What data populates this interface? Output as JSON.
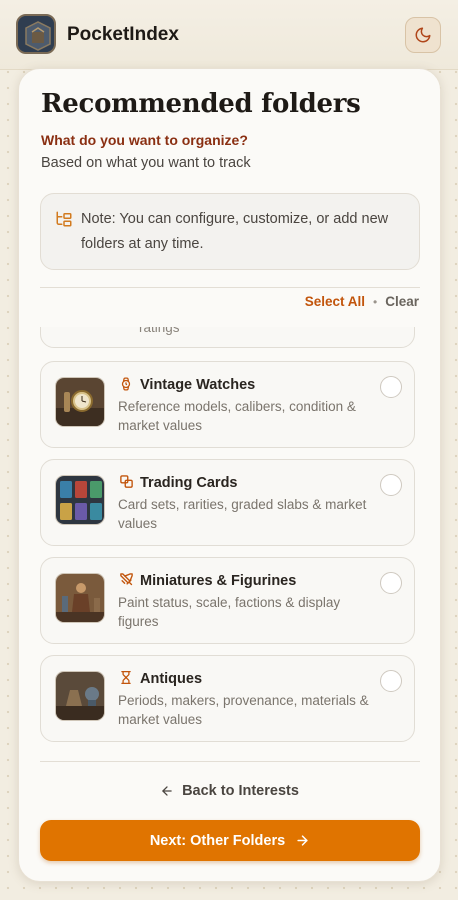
{
  "app": {
    "title": "PocketIndex"
  },
  "header": {
    "title": "Recommended folders",
    "question": "What do you want to organize?",
    "subtitle": "Based on what you want to track"
  },
  "note": {
    "text": "Note: You can configure, customize, or add new folders at any time."
  },
  "selection": {
    "select_all": "Select All",
    "separator": "•",
    "clear": "Clear"
  },
  "folders": [
    {
      "title": "",
      "desc": "ratings",
      "icon": "partial",
      "checked": false
    },
    {
      "title": "Vintage Watches",
      "desc": "Reference models, calibers, condition & market values",
      "icon": "watch-icon",
      "checked": false
    },
    {
      "title": "Trading Cards",
      "desc": "Card sets, rarities, graded slabs & market values",
      "icon": "cards-icon",
      "checked": false
    },
    {
      "title": "Miniatures & Figurines",
      "desc": "Paint status, scale, factions & display figures",
      "icon": "swords-icon",
      "checked": false
    },
    {
      "title": "Antiques",
      "desc": "Periods, makers, provenance, materials & market values",
      "icon": "hourglass-icon",
      "checked": false
    }
  ],
  "footer": {
    "back_label": "Back to Interests",
    "next_label": "Next: Other Folders"
  },
  "colors": {
    "accent": "#e07400",
    "accent_text": "#c2550c",
    "question": "#8a2f12"
  }
}
